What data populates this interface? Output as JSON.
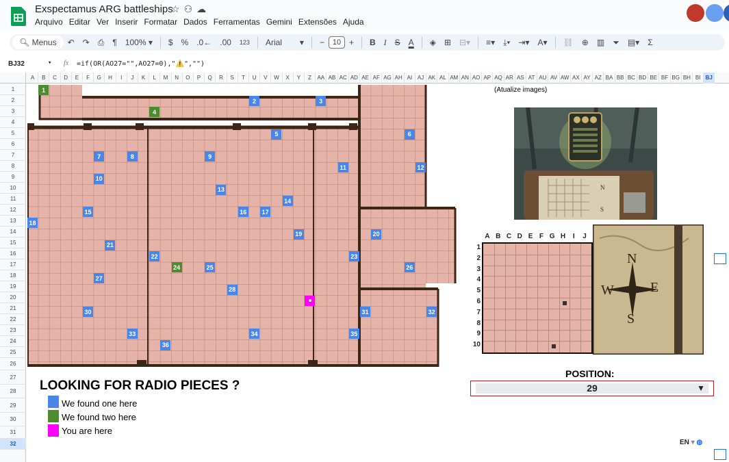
{
  "app": {
    "title": "Exspectamus ARG battleships",
    "menu": [
      "Arquivo",
      "Editar",
      "Ver",
      "Inserir",
      "Formatar",
      "Dados",
      "Ferramentas",
      "Gemini",
      "Extensões",
      "Ajuda"
    ]
  },
  "toolbar": {
    "menus_label": "Menus",
    "zoom": "100%",
    "currency": "$",
    "percent": "%",
    "dec_less": ".0←",
    "dec_more": ".00",
    "number_format": "123",
    "font": "Arial",
    "font_size": "10",
    "minus": "−",
    "plus": "+",
    "bold": "B",
    "italic": "I",
    "strike": "S",
    "text_color": "A",
    "sigma": "Σ"
  },
  "formula_bar": {
    "cell_ref": "BJ32",
    "fx": "fx",
    "formula": "=if(OR(AO27=\"\",AO27=0),\"⚠️\",\"\")"
  },
  "columns": [
    "A",
    "B",
    "C",
    "D",
    "E",
    "F",
    "G",
    "H",
    "I",
    "J",
    "K",
    "L",
    "M",
    "N",
    "O",
    "P",
    "Q",
    "R",
    "S",
    "T",
    "U",
    "V",
    "W",
    "X",
    "Y",
    "Z",
    "AA",
    "AB",
    "AC",
    "AD",
    "AE",
    "AF",
    "AG",
    "AH",
    "AI",
    "AJ",
    "AK",
    "AL",
    "AM",
    "AN",
    "AO",
    "AP",
    "AQ",
    "AR",
    "AS",
    "AT",
    "AU",
    "AV",
    "AW",
    "AX",
    "AY",
    "AZ",
    "BA",
    "BB",
    "BC",
    "BD",
    "BE",
    "BF",
    "BG",
    "BH",
    "BI",
    "BJ"
  ],
  "selected_column": "BJ",
  "rows": [
    "1",
    "2",
    "3",
    "4",
    "5",
    "6",
    "7",
    "8",
    "9",
    "10",
    "11",
    "12",
    "13",
    "14",
    "15",
    "16",
    "17",
    "18",
    "19",
    "20",
    "21",
    "22",
    "23",
    "24",
    "25",
    "26",
    "27",
    "28",
    "29",
    "30",
    "31",
    "32"
  ],
  "selected_row": "32",
  "colors": {
    "one_found": "#4a86e8",
    "two_found": "#4e8b2f",
    "you_are_here": "#ff00ff",
    "map_fill": "#e6b3a8",
    "wall": "#3d2518"
  },
  "map_markers": [
    {
      "label": "1",
      "type": "two",
      "col": 1,
      "row": 1
    },
    {
      "label": "2",
      "type": "one",
      "col": 20,
      "row": 2
    },
    {
      "label": "3",
      "type": "one",
      "col": 26,
      "row": 2
    },
    {
      "label": "4",
      "type": "two",
      "col": 11,
      "row": 3
    },
    {
      "label": "5",
      "type": "one",
      "col": 22,
      "row": 5
    },
    {
      "label": "6",
      "type": "one",
      "col": 34,
      "row": 5
    },
    {
      "label": "7",
      "type": "one",
      "col": 6,
      "row": 7
    },
    {
      "label": "8",
      "type": "one",
      "col": 9,
      "row": 7
    },
    {
      "label": "9",
      "type": "one",
      "col": 16,
      "row": 7
    },
    {
      "label": "10",
      "type": "one",
      "col": 6,
      "row": 9
    },
    {
      "label": "11",
      "type": "one",
      "col": 28,
      "row": 8
    },
    {
      "label": "12",
      "type": "one",
      "col": 35,
      "row": 8
    },
    {
      "label": "13",
      "type": "one",
      "col": 17,
      "row": 10
    },
    {
      "label": "14",
      "type": "one",
      "col": 23,
      "row": 11
    },
    {
      "label": "15",
      "type": "one",
      "col": 5,
      "row": 12
    },
    {
      "label": "16",
      "type": "one",
      "col": 19,
      "row": 12
    },
    {
      "label": "17",
      "type": "one",
      "col": 21,
      "row": 12
    },
    {
      "label": "18",
      "type": "one",
      "col": 0,
      "row": 13
    },
    {
      "label": "19",
      "type": "one",
      "col": 24,
      "row": 14
    },
    {
      "label": "20",
      "type": "one",
      "col": 31,
      "row": 14
    },
    {
      "label": "21",
      "type": "one",
      "col": 7,
      "row": 15
    },
    {
      "label": "22",
      "type": "one",
      "col": 11,
      "row": 16
    },
    {
      "label": "23",
      "type": "one",
      "col": 29,
      "row": 16
    },
    {
      "label": "24",
      "type": "two",
      "col": 13,
      "row": 17
    },
    {
      "label": "25",
      "type": "one",
      "col": 16,
      "row": 17
    },
    {
      "label": "26",
      "type": "one",
      "col": 34,
      "row": 17
    },
    {
      "label": "27",
      "type": "one",
      "col": 6,
      "row": 18
    },
    {
      "label": "28",
      "type": "one",
      "col": 18,
      "row": 19
    },
    {
      "label": "",
      "type": "here",
      "col": 25,
      "row": 20
    },
    {
      "label": "30",
      "type": "one",
      "col": 5,
      "row": 21
    },
    {
      "label": "31",
      "type": "one",
      "col": 30,
      "row": 21
    },
    {
      "label": "32",
      "type": "one",
      "col": 36,
      "row": 21
    },
    {
      "label": "33",
      "type": "one",
      "col": 9,
      "row": 23
    },
    {
      "label": "34",
      "type": "one",
      "col": 20,
      "row": 23
    },
    {
      "label": "35",
      "type": "one",
      "col": 29,
      "row": 23
    },
    {
      "label": "36",
      "type": "one",
      "col": 12,
      "row": 24
    }
  ],
  "legend": {
    "title": "LOOKING FOR RADIO PIECES ?",
    "items": [
      {
        "text": "We found one here",
        "color": "#4a86e8"
      },
      {
        "text": "We found two here",
        "color": "#4e8b2f"
      },
      {
        "text": "You are here",
        "color": "#ff00ff"
      }
    ]
  },
  "right_panel": {
    "update_note": "(Atualize images)",
    "mini_cols": [
      "A",
      "B",
      "C",
      "D",
      "E",
      "F",
      "G",
      "H",
      "I",
      "J"
    ],
    "mini_rows": [
      "1",
      "2",
      "3",
      "4",
      "5",
      "6",
      "7",
      "8",
      "9",
      "10"
    ],
    "mini_dots": [
      {
        "col": "H",
        "row": "6"
      },
      {
        "col": "G",
        "row": "10"
      }
    ],
    "position_label": "POSITION:",
    "position_value": "29",
    "compass_letters": [
      "N",
      "W",
      "E",
      "S"
    ]
  },
  "footer": {
    "language": "EN"
  }
}
